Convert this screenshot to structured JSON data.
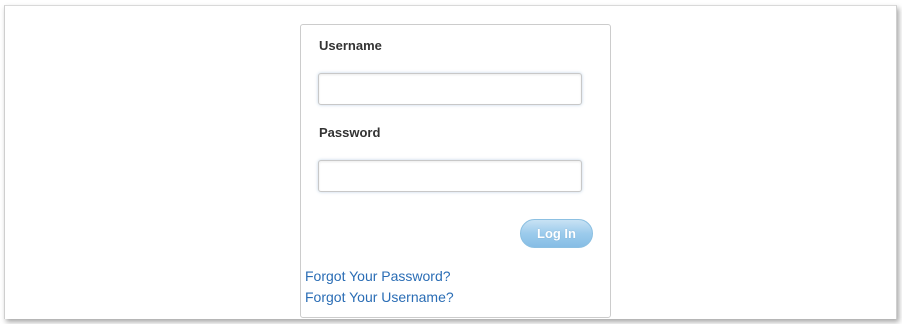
{
  "login_form": {
    "username_label": "Username",
    "username_value": "",
    "password_label": "Password",
    "password_value": "",
    "login_button_label": "Log In"
  },
  "help_links": {
    "forgot_password": "Forgot Your Password?",
    "forgot_username": "Forgot Your Username?"
  },
  "colors": {
    "link": "#2a6db5",
    "button_bg": "#9ccbec",
    "button_text": "#ffffff",
    "label_text": "#333333"
  }
}
